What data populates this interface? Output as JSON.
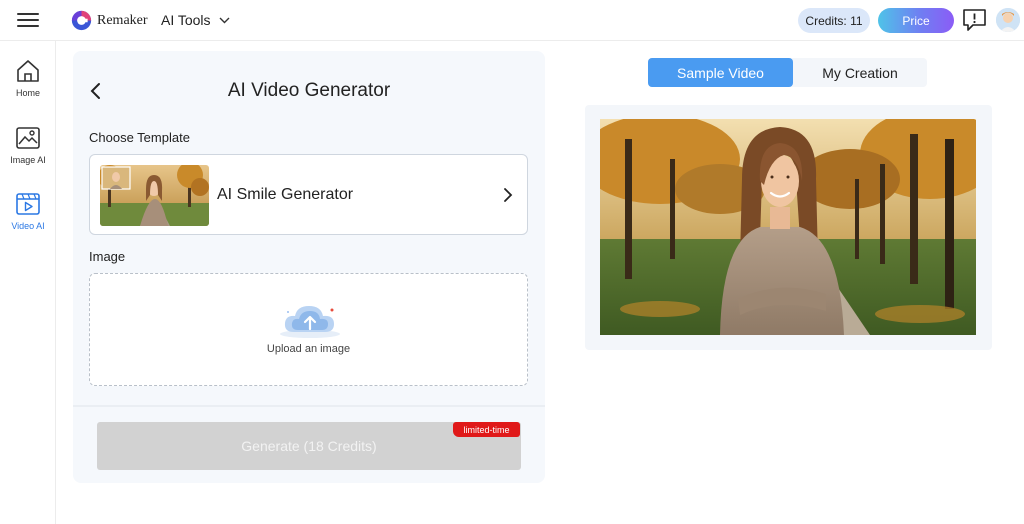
{
  "header": {
    "brand": "Remaker",
    "ai_tools_label": "AI Tools",
    "credits_label": "Credits: 11",
    "price_label": "Price"
  },
  "sidebar": {
    "items": [
      {
        "label": "Home",
        "icon": "home-icon",
        "active": false
      },
      {
        "label": "Image AI",
        "icon": "image-icon",
        "active": false
      },
      {
        "label": "Video AI",
        "icon": "video-icon",
        "active": true
      }
    ]
  },
  "panel": {
    "title": "AI Video Generator",
    "choose_template_label": "Choose Template",
    "template_name": "AI Smile Generator",
    "image_label": "Image",
    "upload_text": "Upload an image",
    "generate_label": "Generate (18 Credits)",
    "badge_label": "limited-time"
  },
  "tabs": [
    {
      "label": "Sample Video",
      "active": true
    },
    {
      "label": "My Creation",
      "active": false
    }
  ],
  "colors": {
    "accent_blue": "#4a9bf1",
    "active_nav": "#2b78e4",
    "badge_red": "#e01919",
    "credits_bg": "#dbe7f9"
  }
}
